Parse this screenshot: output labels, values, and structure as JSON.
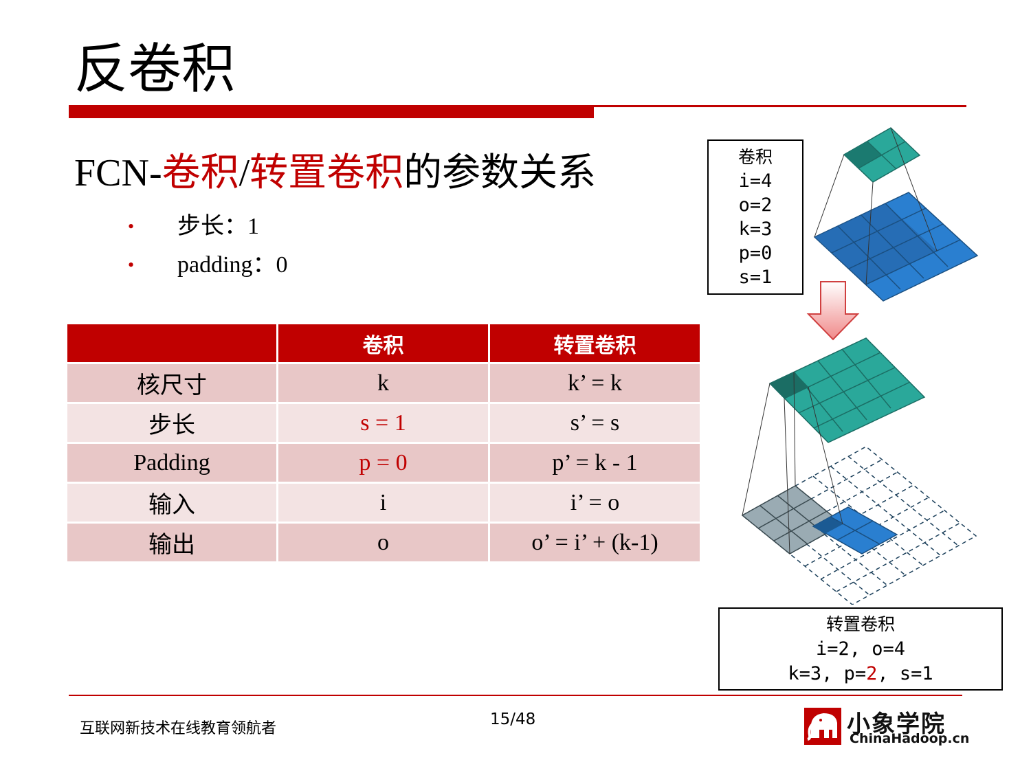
{
  "title": "反卷积",
  "subtitle": {
    "prefix": "FCN-",
    "part1": "卷积",
    "slash": "/",
    "part2": "转置卷积",
    "suffix": "的参数关系"
  },
  "bullets": [
    {
      "dot": "•",
      "text": "步长：1"
    },
    {
      "dot": "•",
      "text": "padding：0"
    }
  ],
  "table": {
    "headers": [
      "",
      "卷积",
      "转置卷积"
    ],
    "rows": [
      {
        "label": "核尺寸",
        "conv": "k",
        "tconv": "k’ = k"
      },
      {
        "label": "步长",
        "conv": "s = 1",
        "tconv": "s’ = s"
      },
      {
        "label": "Padding",
        "conv": "p = 0",
        "tconv": "p’ = k - 1"
      },
      {
        "label": "输入",
        "conv": "i",
        "tconv": "i’ = o"
      },
      {
        "label": "输出",
        "conv": "o",
        "tconv": "o’ =  i’ + (k-1)"
      }
    ]
  },
  "conv_box": {
    "title": "卷积",
    "lines": [
      "i=4",
      "o=2",
      "k=3",
      "p=0",
      "s=1"
    ]
  },
  "tconv_box": {
    "title": "转置卷积",
    "line1": "i=2, o=4",
    "line2_a": "k=3, p=",
    "line2_b": "2",
    "line2_c": ", s=1"
  },
  "footer": {
    "slogan": "互联网新技术在线教育领航者",
    "page": "15/48",
    "logo_cn": "小象学院",
    "logo_en": "ChinaHadoop.cn"
  },
  "colors": {
    "accent": "#c00000",
    "row_odd": "#e8c7c7",
    "row_even": "#f3e3e3",
    "teal": "#2aa89a",
    "blue": "#2a7fd0",
    "gray": "#9aabb3"
  },
  "icons": [
    "elephant-logo-icon",
    "down-arrow-icon"
  ]
}
